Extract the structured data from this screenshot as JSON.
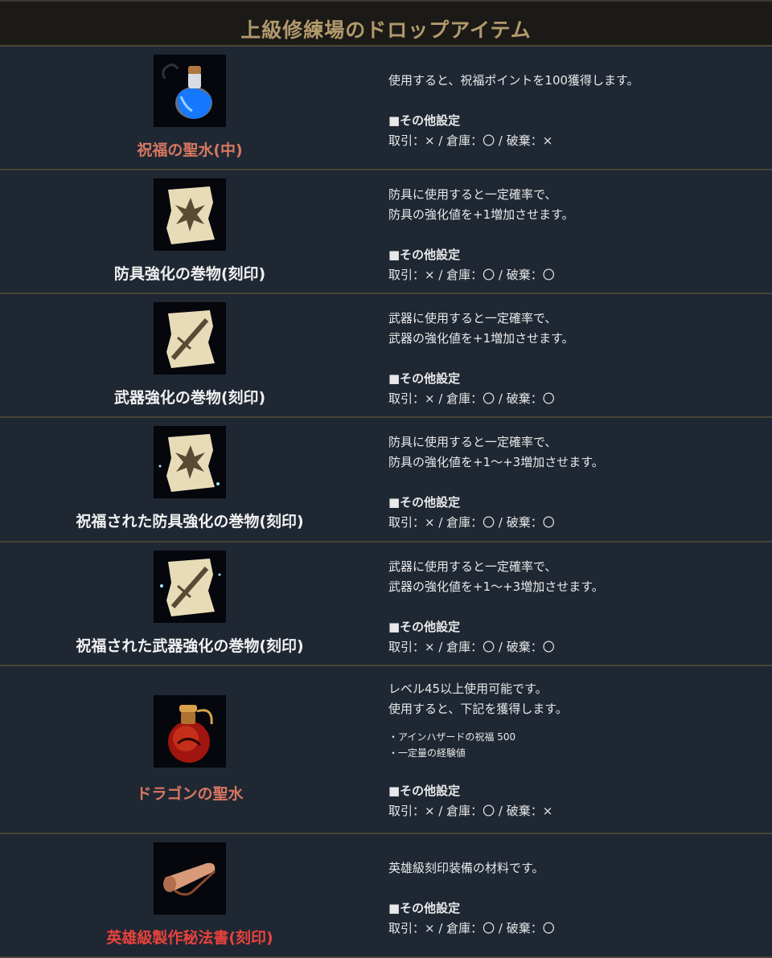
{
  "title": "上級修練場のドロップアイテム",
  "settings_heading": "■その他設定",
  "items": [
    {
      "name": "祝福の聖水(中)",
      "icon": "blue-potion-icon",
      "lines": [
        "使用すると、祝福ポイントを100獲得します。"
      ],
      "settings": "取引：× / 倉庫：〇 / 破棄：×"
    },
    {
      "name": "防具強化の巻物(刻印)",
      "icon": "armor-scroll-icon",
      "lines": [
        "防具に使用すると一定確率で、",
        "防具の強化値を+1増加させます。"
      ],
      "settings": "取引：× / 倉庫：〇 / 破棄：〇"
    },
    {
      "name": "武器強化の巻物(刻印)",
      "icon": "weapon-scroll-icon",
      "lines": [
        "武器に使用すると一定確率で、",
        "武器の強化値を+1増加させます。"
      ],
      "settings": "取引：× / 倉庫：〇 / 破棄：〇"
    },
    {
      "name": "祝福された防具強化の巻物(刻印)",
      "icon": "blessed-armor-scroll-icon",
      "lines": [
        "防具に使用すると一定確率で、",
        "防具の強化値を+1～+3増加させます。"
      ],
      "settings": "取引：× / 倉庫：〇 / 破棄：〇"
    },
    {
      "name": "祝福された武器強化の巻物(刻印)",
      "icon": "blessed-weapon-scroll-icon",
      "lines": [
        "武器に使用すると一定確率で、",
        "武器の強化値を+1～+3増加させます。"
      ],
      "settings": "取引：× / 倉庫：〇 / 破棄：〇"
    },
    {
      "name": "ドラゴンの聖水",
      "icon": "red-potion-icon",
      "lines": [
        "レベル45以上使用可能です。",
        "使用すると、下記を獲得します。"
      ],
      "sublines": [
        "・アインハザードの祝福 500",
        "・一定量の経験値"
      ],
      "settings": "取引：× / 倉庫：〇 / 破棄：×"
    },
    {
      "name": "英雄級製作秘法書(刻印)",
      "icon": "crafting-scroll-icon",
      "lines": [
        "英雄級刻印装備の材料です。"
      ],
      "settings": "取引：× / 倉庫：〇 / 破棄：〇"
    }
  ]
}
